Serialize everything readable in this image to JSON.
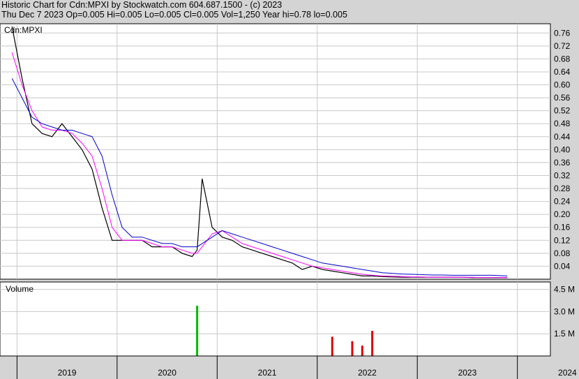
{
  "header": {
    "line1": "Historic Chart for Cdn:MPXI by Stockwatch.com 604.687.1500 - (c) 2023",
    "line2": "Thu Dec  7 2023  Op=0.005  Hi=0.005  Lo=0.005  Cl=0.005  Vol=1,250  Year hi=0.78  lo=0.005"
  },
  "chart_data": [
    {
      "type": "line",
      "title": "Cdn:MPXI",
      "ylim": [
        0,
        0.78
      ],
      "y_ticks": [
        "0.76",
        "0.72",
        "0.68",
        "0.64",
        "0.60",
        "0.56",
        "0.52",
        "0.48",
        "0.44",
        "0.40",
        "0.36",
        "0.32",
        "0.28",
        "0.24",
        "0.20",
        "0.16",
        "0.12",
        "0.08",
        "0.04"
      ],
      "x_ticks": [
        "2019",
        "2020",
        "2021",
        "2022",
        "2023",
        "2024"
      ],
      "x": [
        2018.95,
        2019.05,
        2019.15,
        2019.25,
        2019.35,
        2019.45,
        2019.55,
        2019.65,
        2019.75,
        2019.85,
        2019.95,
        2020.05,
        2020.15,
        2020.25,
        2020.35,
        2020.45,
        2020.55,
        2020.65,
        2020.75,
        2020.8,
        2020.85,
        2020.95,
        2021.05,
        2021.15,
        2021.25,
        2021.35,
        2021.45,
        2021.55,
        2021.65,
        2021.75,
        2021.85,
        2021.95,
        2022.05,
        2022.15,
        2022.25,
        2022.35,
        2022.45,
        2022.55,
        2022.65,
        2022.75,
        2022.85,
        2022.95,
        2023.05,
        2023.15,
        2023.25,
        2023.35,
        2023.45,
        2023.55,
        2023.65,
        2023.75,
        2023.9
      ],
      "series": [
        {
          "values": [
            0.78,
            0.62,
            0.48,
            0.45,
            0.44,
            0.48,
            0.44,
            0.4,
            0.34,
            0.22,
            0.12,
            0.12,
            0.12,
            0.12,
            0.1,
            0.1,
            0.1,
            0.08,
            0.07,
            0.09,
            0.31,
            0.16,
            0.13,
            0.12,
            0.1,
            0.09,
            0.08,
            0.07,
            0.06,
            0.05,
            0.03,
            0.04,
            0.03,
            0.025,
            0.02,
            0.015,
            0.01,
            0.01,
            0.008,
            0.007,
            0.006,
            0.006,
            0.006,
            0.006,
            0.006,
            0.006,
            0.006,
            0.005,
            0.005,
            0.005,
            0.005
          ]
        },
        {
          "values": [
            0.7,
            0.6,
            0.52,
            0.47,
            0.46,
            0.46,
            0.45,
            0.42,
            0.38,
            0.28,
            0.16,
            0.12,
            0.12,
            0.12,
            0.11,
            0.1,
            0.1,
            0.09,
            0.08,
            0.08,
            0.1,
            0.14,
            0.15,
            0.13,
            0.11,
            0.1,
            0.09,
            0.08,
            0.07,
            0.06,
            0.05,
            0.04,
            0.035,
            0.03,
            0.025,
            0.02,
            0.015,
            0.012,
            0.01,
            0.009,
            0.008,
            0.007,
            0.007,
            0.006,
            0.006,
            0.006,
            0.006,
            0.006,
            0.005,
            0.005,
            0.005
          ]
        },
        {
          "values": [
            0.62,
            0.56,
            0.5,
            0.48,
            0.47,
            0.46,
            0.46,
            0.45,
            0.44,
            0.38,
            0.26,
            0.16,
            0.13,
            0.13,
            0.12,
            0.11,
            0.11,
            0.1,
            0.1,
            0.1,
            0.11,
            0.13,
            0.15,
            0.14,
            0.13,
            0.12,
            0.11,
            0.1,
            0.09,
            0.08,
            0.07,
            0.06,
            0.05,
            0.045,
            0.04,
            0.035,
            0.03,
            0.025,
            0.02,
            0.018,
            0.016,
            0.015,
            0.014,
            0.013,
            0.013,
            0.012,
            0.012,
            0.012,
            0.012,
            0.012,
            0.01
          ]
        }
      ]
    },
    {
      "type": "bar",
      "title": "Volume",
      "ylim": [
        0,
        5
      ],
      "y_ticks": [
        "4.5 M",
        "3.0 M",
        "1.5 M"
      ],
      "x": [
        2020.8,
        2022.15,
        2022.35,
        2022.45,
        2022.55
      ],
      "values": [
        3.4,
        1.3,
        1.0,
        0.7,
        1.7
      ]
    }
  ],
  "colors": {
    "price": "#000000",
    "ma_short": "#ff00ff",
    "ma_long": "#0000cc",
    "vol_up": "#00bb00",
    "vol_down": "#dd0000",
    "grid": "#c8c8c8",
    "panel_bg": "#ffffff"
  }
}
